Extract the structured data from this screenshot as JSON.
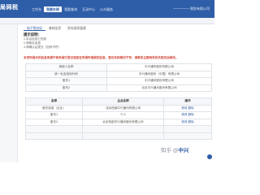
{
  "app": {
    "logo": "局网税"
  },
  "nav": [
    "工作台",
    "我要办税",
    "我要查询",
    "互动中心",
    "公众服务"
  ],
  "nav_active_index": 1,
  "user_text": "一一一一一 税务有限公司",
  "tabs": [
    "电子税务局",
    "基础信息",
    "财务报表备案"
  ],
  "tab_active_index": 0,
  "notice": {
    "title": "提示说明：",
    "lines": [
      "1.实名信息已完成",
      "2.请核实信息",
      "3.请确认后提交（如有不符）"
    ],
    "tip": "本页所展示的信息来源于税务局已登记或您在申报时填报的信息，若与实际情况不符，请联系主管税务机关核实后修改。"
  },
  "form_rows": [
    {
      "label": "纳税人名称",
      "value": "中兴通讯股份有限公司"
    },
    {
      "label": "统一社会信用代码",
      "value": "中兴通讯股份（中国）有限公司"
    },
    {
      "label": "股东1",
      "value": "中兴通讯股份有限公司"
    },
    {
      "label": "股东2",
      "value": "北京中兴通讯股份有限公司"
    }
  ],
  "table": {
    "headers": [
      "名称",
      "企业名称",
      "操作"
    ],
    "rows": [
      {
        "name": "股东信息（企业）",
        "company": "北京西部中兴通讯有限公司",
        "action": "修改 删除"
      },
      {
        "name": "股东1",
        "company": "个人",
        "action": "修改 删除"
      },
      {
        "name": "股东2",
        "company": "北京西部中兴通讯股份有限公司",
        "action": "修改 删除"
      }
    ]
  },
  "watermark": {
    "prefix": "知乎 @",
    "brand": "中兴"
  }
}
